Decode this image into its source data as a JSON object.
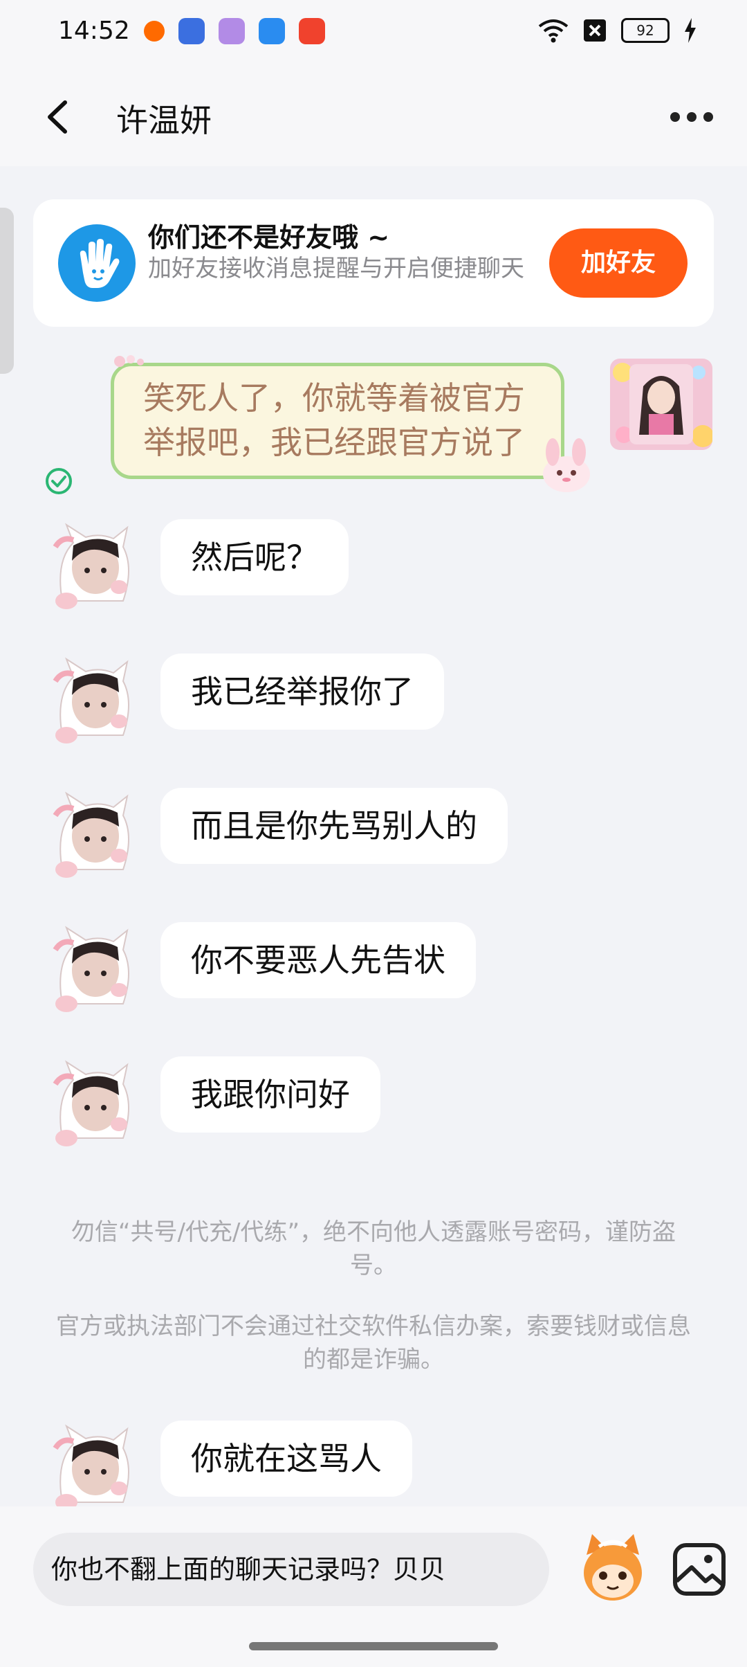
{
  "status_bar": {
    "time": "14:52",
    "battery": "92"
  },
  "header": {
    "title": "许温妍"
  },
  "friend_banner": {
    "title": "你们还不是好友哦 ~",
    "subtitle": "加好友接收消息提醒与开启便捷聊天",
    "button": "加好友"
  },
  "sent_message": {
    "text": "笑死人了，你就等着被官方举报吧，我已经跟官方说了"
  },
  "received_messages": [
    {
      "text": "然后呢？"
    },
    {
      "text": "我已经举报你了"
    },
    {
      "text": "而且是你先骂别人的"
    },
    {
      "text": "你不要恶人先告状"
    },
    {
      "text": "我跟你问好"
    },
    {
      "text": "你就在这骂人"
    }
  ],
  "notices": [
    "勿信“共号/代充/代练”，绝不向他人透露账号密码，谨防盗号。",
    "官方或执法部门不会通过社交软件私信办案，索要钱财或信息的都是诈骗。"
  ],
  "input": {
    "value": "你也不翻上面的聊天记录吗？贝贝"
  },
  "colors": {
    "accent": "#ff5a14",
    "bubble_border": "#a8d78a",
    "check": "#2bb673"
  },
  "icons": [
    "back-arrow-icon",
    "more-dots-icon",
    "wave-hand-icon",
    "read-check-icon",
    "sticker-icon",
    "image-icon",
    "wifi-icon",
    "sim-off-icon",
    "charging-icon"
  ]
}
